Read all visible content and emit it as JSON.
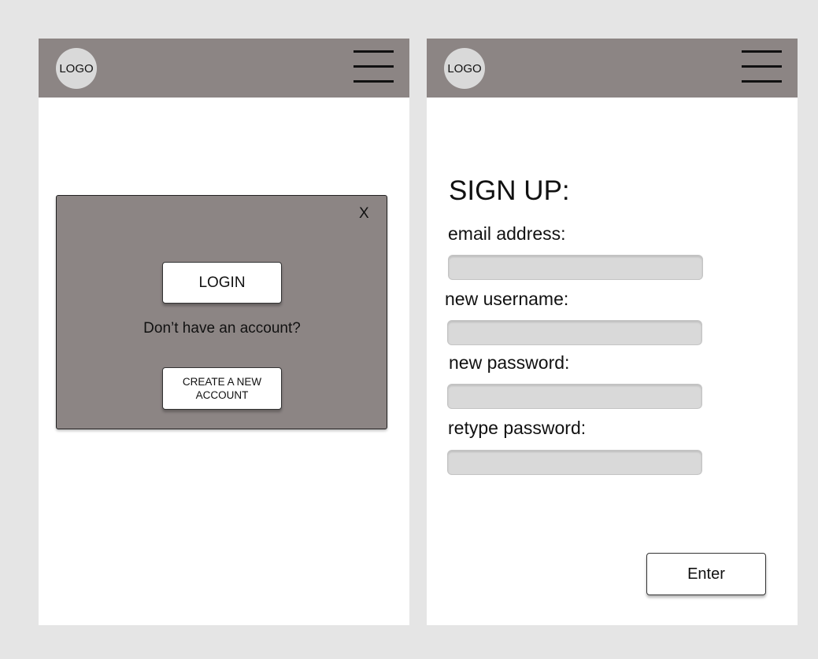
{
  "login_screen": {
    "logo_text": "LOGO",
    "modal": {
      "close_label": "X",
      "login_label": "LOGIN",
      "no_account_text": "Don’t have an account?",
      "create_account_label": "CREATE A NEW ACCOUNT"
    }
  },
  "signup_screen": {
    "logo_text": "LOGO",
    "title": "SIGN UP:",
    "fields": [
      {
        "label": "email address:",
        "value": ""
      },
      {
        "label": "new username:",
        "value": ""
      },
      {
        "label": "new password:",
        "value": ""
      },
      {
        "label": "retype password:",
        "value": ""
      }
    ],
    "enter_label": "Enter"
  },
  "colors": {
    "background": "#e5e5e5",
    "header": "#8c8584",
    "modal": "#8c8584",
    "logo_circle": "#d9d9d9",
    "input": "#d9d9d9",
    "screen": "#ffffff"
  },
  "icons": {
    "menu": "hamburger-menu-icon",
    "close": "close-icon"
  }
}
